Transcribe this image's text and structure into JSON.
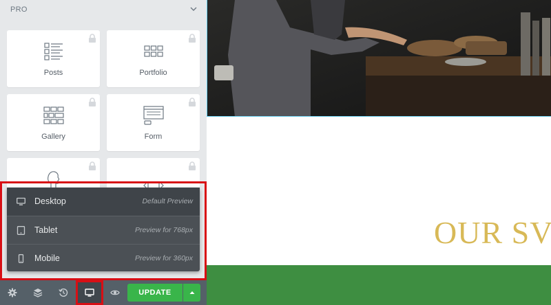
{
  "panel": {
    "section_title": "PRO",
    "widgets": [
      {
        "label": "Posts",
        "icon": "posts-icon",
        "locked": true
      },
      {
        "label": "Portfolio",
        "icon": "portfolio-icon",
        "locked": true
      },
      {
        "label": "Gallery",
        "icon": "gallery-icon",
        "locked": true
      },
      {
        "label": "Form",
        "icon": "form-icon",
        "locked": true
      },
      {
        "label": "",
        "icon": "login-icon",
        "locked": true
      },
      {
        "label": "",
        "icon": "slides-icon",
        "locked": true
      }
    ]
  },
  "responsive_menu": {
    "items": [
      {
        "label": "Desktop",
        "description": "Default Preview",
        "icon": "desktop-icon",
        "active": true
      },
      {
        "label": "Tablet",
        "description": "Preview for 768px",
        "icon": "tablet-icon",
        "active": false
      },
      {
        "label": "Mobile",
        "description": "Preview for 360px",
        "icon": "mobile-icon",
        "active": false
      }
    ]
  },
  "footer": {
    "buttons": [
      "settings-icon",
      "navigator-icon",
      "history-icon",
      "responsive-mode-icon",
      "preview-icon"
    ],
    "update_label": "UPDATE"
  },
  "canvas": {
    "heading": "OUR SV"
  },
  "colors": {
    "panel_bg": "#e6e8ea",
    "footer_bg": "#556068",
    "update_green": "#39b54a",
    "highlight_red": "#d80f15",
    "heading_gold": "#d8b957",
    "band_green": "#3e8e41"
  }
}
